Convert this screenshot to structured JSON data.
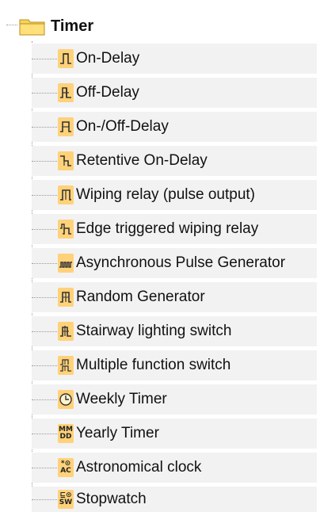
{
  "tree": {
    "root": {
      "label": "Timer",
      "icon": "folder-icon",
      "color": "#f4c542"
    },
    "items": [
      {
        "label": "On-Delay",
        "icon": "on-delay-icon"
      },
      {
        "label": "Off-Delay",
        "icon": "off-delay-icon"
      },
      {
        "label": "On-/Off-Delay",
        "icon": "on-off-delay-icon"
      },
      {
        "label": "Retentive On-Delay",
        "icon": "retentive-on-delay-icon"
      },
      {
        "label": "Wiping relay (pulse output)",
        "icon": "wiping-relay-icon"
      },
      {
        "label": "Edge triggered wiping relay",
        "icon": "edge-triggered-icon"
      },
      {
        "label": "Asynchronous Pulse Generator",
        "icon": "pulse-generator-icon"
      },
      {
        "label": "Random Generator",
        "icon": "random-generator-icon"
      },
      {
        "label": "Stairway lighting switch",
        "icon": "stairway-switch-icon"
      },
      {
        "label": "Multiple function switch",
        "icon": "multiple-function-icon"
      },
      {
        "label": "Weekly Timer",
        "icon": "clock-icon"
      },
      {
        "label": "Yearly Timer",
        "icon": "mm-dd-icon",
        "icon_text": [
          "MM",
          "DD"
        ]
      },
      {
        "label": "Astronomical clock",
        "icon": "ac-icon",
        "icon_text": [
          "*⊙",
          "AC"
        ]
      },
      {
        "label": "Stopwatch",
        "icon": "sw-icon",
        "icon_text": [
          "⊑⊙",
          "SW"
        ]
      }
    ]
  }
}
